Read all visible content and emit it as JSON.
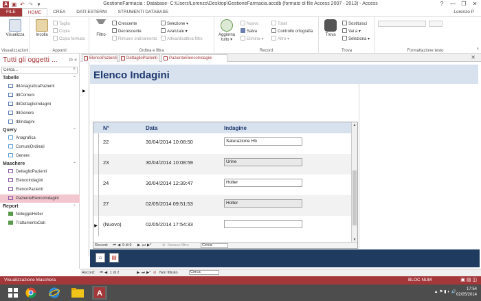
{
  "titlebar": {
    "title": "GestioneFarmacia : Database- C:\\Users\\Lorenzo\\Desktop\\GestioneFarmacia.accdb (formato di file Access 2007 - 2013) - Access",
    "help": "?",
    "minimize": "—",
    "restore": "❐",
    "close": "✕"
  },
  "ribbon_tabs": [
    {
      "label": "FILE"
    },
    {
      "label": "HOME"
    },
    {
      "label": "CREA"
    },
    {
      "label": "DATI ESTERNI"
    },
    {
      "label": "STRUMENTI DATABASE"
    }
  ],
  "user": "Lorenzo P",
  "ribbon": {
    "views": {
      "label": "Visualizzazioni",
      "visualizza": "Visualizza"
    },
    "clipboard": {
      "label": "Appunti",
      "incolla": "Incolla",
      "taglia": "Taglia",
      "copia": "Copia",
      "copia_formato": "Copia formato"
    },
    "sort_filter": {
      "label": "Ordina e filtra",
      "filtro": "Filtro",
      "crescente": "Crescente",
      "decrescente": "Decrescente",
      "rimuovi": "Rimuovi ordinamento",
      "selezione": "Selezione ▾",
      "avanzate": "Avanzate ▾",
      "attiva": "Attiva/disattiva filtro"
    },
    "record": {
      "label": "Record",
      "aggiorna": "Aggiorna tutto ▾",
      "nuovo": "Nuovo",
      "salva": "Salva",
      "elimina": "Elimina ▾",
      "totali": "Totali",
      "controllo": "Controllo ortografia",
      "altro": "Altro ▾"
    },
    "find": {
      "label": "Trova",
      "trova": "Trova",
      "sostituisci": "Sostituisci",
      "vai": "Vai a ▾",
      "seleziona": "Seleziona ▾"
    },
    "text_format": {
      "label": "Formattazione testo"
    }
  },
  "nav_pane": {
    "title": "Tutti gli oggetti ...",
    "search_value": "Cerca...",
    "sections": [
      {
        "name": "Tabelle",
        "items": [
          "tblAnagraficaPazienti",
          "tblComuni",
          "tblDettaglioIndagini",
          "tblGenere",
          "tblIndagini"
        ]
      },
      {
        "name": "Query",
        "items": [
          "Anagrafica",
          "ComuniOrdinati",
          "Genere"
        ]
      },
      {
        "name": "Maschere",
        "items": [
          "DettaglioPazienti",
          "ElencoIndagini",
          "ElencoPazienti",
          "PazienteElencoIndagini"
        ]
      },
      {
        "name": "Report",
        "items": [
          "NoleggioHolter",
          "TrattamentoDati"
        ]
      }
    ],
    "selected": "PazienteElencoIndagini"
  },
  "doc_tabs": [
    {
      "label": "ElencoPazienti"
    },
    {
      "label": "DettaglioPazienti"
    },
    {
      "label": "PazienteElencoIndagini"
    }
  ],
  "form": {
    "title": "Elenco Indagini",
    "subform": {
      "columns": [
        "N°",
        "Data",
        "Indagine"
      ],
      "rows": [
        {
          "n": "22",
          "data": "30/04/2014 10:08:50",
          "indagine": "Saturazione Hb",
          "sel": ""
        },
        {
          "n": "23",
          "data": "30/04/2014 10:08:59",
          "indagine": "Urine",
          "sel": ""
        },
        {
          "n": "24",
          "data": "30/04/2014 12:39:47",
          "indagine": "Holter",
          "sel": ""
        },
        {
          "n": "27",
          "data": "02/05/2014 09:51:53",
          "indagine": "Holter",
          "sel": ""
        },
        {
          "n": "(Nuovo)",
          "data": "02/05/2014 17:54:33",
          "indagine": "",
          "sel": "▶"
        }
      ],
      "navbar": {
        "record_label": "Record:",
        "position": "9 di 9",
        "filter": "Nessun filtro",
        "search": "Cerca"
      }
    }
  },
  "main_navbar": {
    "record_label": "Record:",
    "position": "1 di 2",
    "filter": "Non filtrato",
    "search": "Cerca"
  },
  "status": {
    "left": "Visualizzazione Maschera",
    "num": "BLOC NUM"
  },
  "taskbar": {
    "time": "17:54",
    "date": "02/05/2014"
  }
}
